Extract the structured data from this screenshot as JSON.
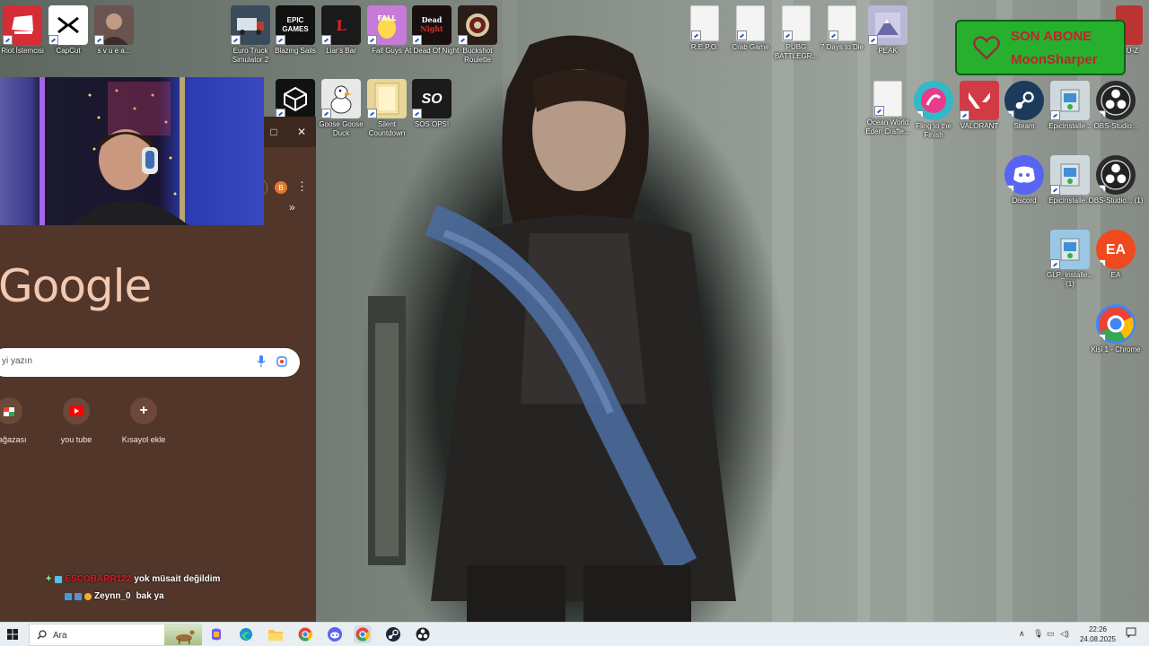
{
  "desktop": {
    "icons": [
      {
        "label": "Riot İstemcisi",
        "icon": "riot-client-icon",
        "color": "#d62c35"
      },
      {
        "label": "CapCut",
        "icon": "capcut-icon",
        "color": "#ffffff"
      },
      {
        "label": "s v u e a...",
        "icon": "photo-icon",
        "color": "#8a6f6a"
      },
      {
        "label": "Euro Truck Simulator 2",
        "icon": "euro-truck-icon",
        "color": "#3a4b5c"
      },
      {
        "label": "Blazing Sails",
        "icon": "epic-games-icon",
        "color": "#111111",
        "glyph": "EPIC\nGAMES"
      },
      {
        "label": "Liar's Bar",
        "icon": "liars-bar-icon",
        "color": "#1a1a1a",
        "glyph": "L"
      },
      {
        "label": "Fall Guys",
        "icon": "fall-guys-icon",
        "color": "#c77bd8"
      },
      {
        "label": "At Dead Of Night",
        "icon": "at-dead-of-night-icon",
        "color": "#1a0f0f"
      },
      {
        "label": "Buckshot Roulette",
        "icon": "buckshot-roulette-icon",
        "color": "#2a1c16"
      },
      {
        "label": "R.E.P.O.",
        "icon": "file-icon"
      },
      {
        "label": "Crab Game",
        "icon": "file-icon"
      },
      {
        "label": "PUBG BATTLEGR...",
        "icon": "file-icon"
      },
      {
        "label": "7 Days to Die",
        "icon": "file-icon"
      },
      {
        "label": "PEAK",
        "icon": "peak-icon",
        "color": "#b9b9d6"
      },
      {
        "label": "",
        "icon": "unity-icon",
        "color": "#111111"
      },
      {
        "label": "Goose Goose Duck",
        "icon": "goose-icon",
        "color": "#e8e8e8"
      },
      {
        "label": "Silent Countdown",
        "icon": "folder-icon",
        "color": "#e8d59a"
      },
      {
        "label": "SOS OPS!",
        "icon": "sos-ops-icon",
        "color": "#1b1b1b",
        "glyph": "SO"
      },
      {
        "label": "Ocean World Eden Crafte...",
        "icon": "file-icon"
      },
      {
        "label": "Fling to the Finish",
        "icon": "fling-icon",
        "color": "#33b8c8"
      },
      {
        "label": "VALORANT",
        "icon": "valorant-icon",
        "color": "#d23b44"
      },
      {
        "label": "Steam",
        "icon": "steam-icon",
        "color": "#1b3a5c"
      },
      {
        "label": "EpicInstalle...",
        "icon": "installer-icon",
        "color": "#cfd8dc"
      },
      {
        "label": "OBS-Studio...",
        "icon": "obs-icon",
        "color": "#2b2b2b"
      },
      {
        "label": "Discord",
        "icon": "discord-icon",
        "color": "#5865f2"
      },
      {
        "label": "EpicInstalle...",
        "icon": "installer-icon",
        "color": "#cfd8dc"
      },
      {
        "label": "OBS-Studio... (1)",
        "icon": "obs-icon",
        "color": "#2b2b2b"
      },
      {
        "label": "GLP_installe... (1)",
        "icon": "glp-installer-icon",
        "color": "#9bc7e6"
      },
      {
        "label": "EA",
        "icon": "ea-icon",
        "color": "#ee4a1f",
        "glyph": "EA"
      },
      {
        "label": "Kişi 1 - Chrome",
        "icon": "chrome-icon",
        "color": "#4285f4"
      },
      {
        "label": "...U-Z",
        "icon": "partial-icon",
        "color": "#b33"
      }
    ]
  },
  "chrome": {
    "avatar_letter": "B",
    "google_logo": "Google",
    "search_placeholder": "yi yazın",
    "shortcuts": [
      {
        "label": "Mağazası",
        "icon": "store-icon"
      },
      {
        "label": "you tube",
        "icon": "youtube-icon"
      },
      {
        "label": "Kısayol ekle",
        "icon": "plus-icon"
      }
    ]
  },
  "overlay": {
    "badge_title": "SON ABONE",
    "badge_name": "MoonSharper",
    "chat": [
      {
        "user": "ESCOBARR122",
        "message": "yok müsait değildim"
      },
      {
        "user": "Zeynn_0",
        "message": "bak ya"
      }
    ]
  },
  "taskbar": {
    "search_text": "Ara",
    "time": "22:26",
    "date": "24.08.2025",
    "apps": [
      "copilot-icon",
      "edge-icon",
      "file-explorer-icon",
      "chrome-icon",
      "discord-icon",
      "chrome-profile-icon",
      "steam-icon",
      "obs-icon"
    ]
  },
  "colors": {
    "badge_bg": "#27b02e",
    "badge_text": "#c0242c",
    "chrome_bg": "#53362a",
    "taskbar_bg": "#e9eef2"
  }
}
